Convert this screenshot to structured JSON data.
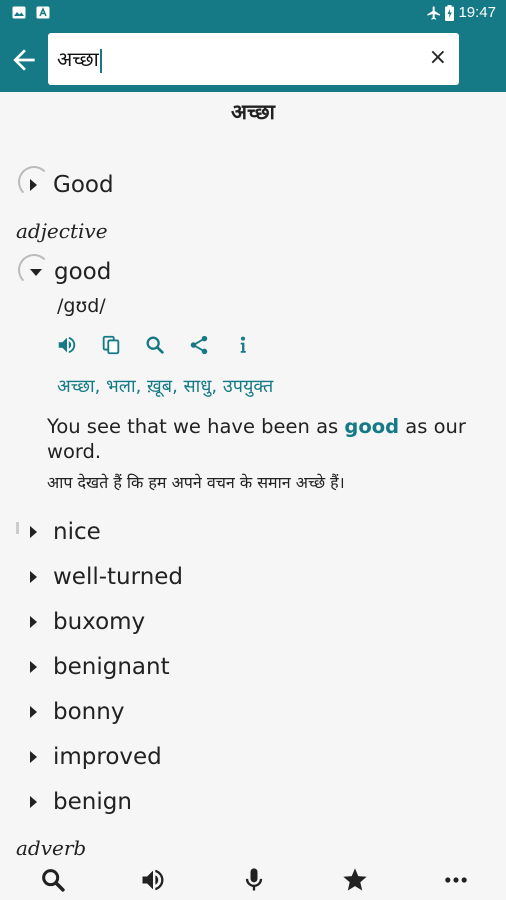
{
  "status_bar": {
    "time": "19:47",
    "left_icons": [
      "image-icon",
      "text-icon"
    ],
    "right_icons": [
      "airplane-mode-icon",
      "battery-icon"
    ]
  },
  "search": {
    "query": "अच्छा",
    "clear_label": "×"
  },
  "entry": {
    "headword": "अच्छा",
    "top_result": "Good",
    "sections": [
      {
        "pos": "adjective",
        "expanded_word": {
          "word": "good",
          "pronunciation": "/gʊd/",
          "actions": [
            "speaker-icon",
            "copy-icon",
            "search-icon",
            "share-icon",
            "info-icon"
          ],
          "synonyms": "अच्छा, भला, ख़ूब, साधु, उपयुक्त",
          "example_before": "You see that we have been as ",
          "example_highlight": "good",
          "example_after": " as our word.",
          "example_translation": "आप देखते हैं कि हम अपने वचन के समान अच्छे हैं।"
        },
        "other_words": [
          "nice",
          "well-turned",
          "buxomy",
          "benignant",
          "bonny",
          "improved",
          "benign"
        ]
      },
      {
        "pos": "adverb"
      }
    ]
  },
  "bottom_bar": [
    "search-icon",
    "speaker-icon",
    "microphone-icon",
    "star-icon",
    "more-icon"
  ],
  "colors": {
    "primary": "#157a85",
    "background": "#f6f6f6"
  }
}
